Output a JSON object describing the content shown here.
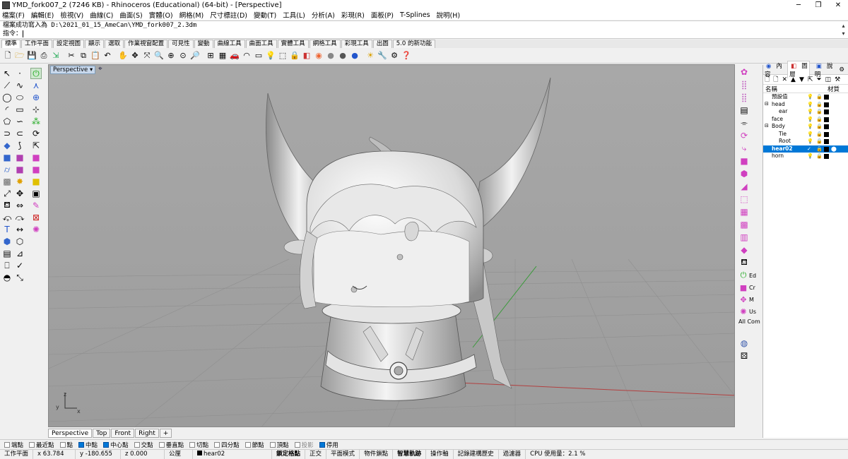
{
  "window": {
    "title": "YMD_fork007_2 (7246 KB) - Rhinoceros (Educational) (64-bit) - [Perspective]",
    "controls": [
      "─",
      "❐",
      "✕"
    ]
  },
  "menu": [
    "檔案(F)",
    "編輯(E)",
    "檢視(V)",
    "曲線(C)",
    "曲面(S)",
    "實體(O)",
    "網格(M)",
    "尺寸標註(D)",
    "變動(T)",
    "工具(L)",
    "分析(A)",
    "彩現(R)",
    "面板(P)",
    "T-Splines",
    "說明(H)"
  ],
  "command": {
    "history": "檔案成功寫入為 D:\\2021_01_15_AmeCan\\YMD_fork007_2.3dm",
    "prompt": "指令："
  },
  "toolbar_tabs": [
    "標準",
    "工作平面",
    "設定視圖",
    "顯示",
    "選取",
    "作業視窗配置",
    "可見性",
    "變動",
    "曲線工具",
    "曲面工具",
    "實體工具",
    "網格工具",
    "彩現工具",
    "出圖",
    "5.0 的新功能"
  ],
  "toolbar_icons": [
    "new-file-icon",
    "open-folder-icon",
    "save-icon",
    "print-icon",
    "import-icon",
    "cut-icon",
    "copy-icon",
    "paste-icon",
    "undo-icon",
    "pan-icon",
    "rotate-view-icon",
    "move-view-icon",
    "zoom-window-icon",
    "zoom-extents-icon",
    "zoom-selected-icon",
    "zoom-icon",
    "viewport-layout-icon",
    "cplane-icon",
    "car-icon",
    "fillet-icon",
    "named-view-icon",
    "light-icon",
    "select-icon",
    "lock-icon",
    "layer-icon",
    "color-wheel-icon",
    "shaded-icon",
    "rendered-icon",
    "render-icon",
    "sun-icon",
    "tools-icon",
    "options-icon",
    "help-icon"
  ],
  "viewport": {
    "label": "Perspective",
    "dropdown": "▾",
    "axis_z": "z",
    "axis_y": "y",
    "axis_x": "x"
  },
  "view_tabs": [
    "Perspective",
    "Top",
    "Front",
    "Right",
    "+"
  ],
  "right_tools_labels": [
    "Ed",
    "Cr",
    "M",
    "Us",
    "All Com"
  ],
  "panel": {
    "tabs": [
      "內容",
      "圖層",
      "說明"
    ],
    "header_name": "名稱",
    "header_material": "材質",
    "layers": [
      {
        "name": "預設值",
        "indent": 0,
        "expand": "",
        "selected": false
      },
      {
        "name": "head",
        "indent": 0,
        "expand": "⊟",
        "selected": false
      },
      {
        "name": "ear",
        "indent": 1,
        "expand": "",
        "selected": false
      },
      {
        "name": "face",
        "indent": 0,
        "expand": "",
        "selected": false
      },
      {
        "name": "Body",
        "indent": 0,
        "expand": "⊟",
        "selected": false
      },
      {
        "name": "Tie",
        "indent": 1,
        "expand": "",
        "selected": false
      },
      {
        "name": "Root",
        "indent": 1,
        "expand": "",
        "selected": false
      },
      {
        "name": "hear02",
        "indent": 0,
        "expand": "",
        "selected": true
      },
      {
        "name": "horn",
        "indent": 0,
        "expand": "",
        "selected": false
      }
    ]
  },
  "osnaps": [
    {
      "label": "端點",
      "on": false
    },
    {
      "label": "最近點",
      "on": false
    },
    {
      "label": "點",
      "on": false
    },
    {
      "label": "中點",
      "on": true
    },
    {
      "label": "中心點",
      "on": true
    },
    {
      "label": "交點",
      "on": false
    },
    {
      "label": "垂直點",
      "on": false
    },
    {
      "label": "切點",
      "on": false
    },
    {
      "label": "四分點",
      "on": false
    },
    {
      "label": "節點",
      "on": false
    },
    {
      "label": "頂點",
      "on": false
    },
    {
      "label": "投影",
      "on": false,
      "dim": true
    },
    {
      "label": "停用",
      "on": true
    }
  ],
  "status": {
    "cplane": "工作平面",
    "x": "x 63.784",
    "y": "y -180.655",
    "z": "z 0.000",
    "unit": "公厘",
    "layer": "hear02",
    "toggles": [
      "鎖定格點",
      "正交",
      "平面模式",
      "物件鎖點",
      "智慧軌跡",
      "操作軸",
      "記錄建構歷史",
      "過濾器"
    ],
    "bold_toggles": [
      "鎖定格點",
      "智慧軌跡"
    ],
    "cpu": "CPU 使用量：2.1 %"
  }
}
